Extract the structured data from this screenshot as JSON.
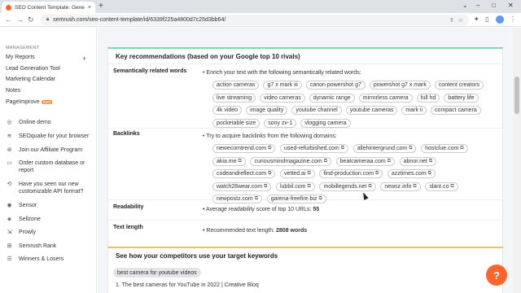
{
  "browser": {
    "tab_title": "SEO Content Template: Generate",
    "tab_close": "×",
    "new_tab": "+",
    "url": "semrush.com/seo-content-template/id/6339f225a4800d7c25d3bb64/",
    "lock_icon": "lock-icon",
    "window_controls": [
      "⌄",
      "–",
      "□",
      "✕"
    ]
  },
  "sidebar": {
    "section_label": "MANAGEMENT",
    "my_reports": "My Reports",
    "lead_gen": "Lead Generation Tool",
    "marketing_calendar": "Marketing Calendar",
    "notes": "Notes",
    "pageimprove": "PageImprove",
    "beta": "Beta",
    "items": [
      {
        "icon": "◎",
        "label": "Online demo"
      },
      {
        "icon": "≋",
        "label": "SEOquake for your browser"
      },
      {
        "icon": "⊛",
        "label": "Join our Affiliate Program"
      },
      {
        "icon": "▭",
        "label": "Order custom database or report"
      },
      {
        "icon": "⟲",
        "label": "Have you seen our new customizable API format?"
      },
      {
        "icon": "◉",
        "label": "Sensor"
      },
      {
        "icon": "◈",
        "label": "Sellzone"
      },
      {
        "icon": "⇲",
        "label": "Prowly"
      },
      {
        "icon": "⊞",
        "label": "Semrush Rank"
      },
      {
        "icon": "☰",
        "label": "Winners & Losers"
      }
    ]
  },
  "recommendations": {
    "title": "Key recommendations (based on your Google top 10 rivals)",
    "semantic": {
      "label": "Semantically related words",
      "intro": "• Enrich your text with the following semantically related words:",
      "words": [
        "action cameras",
        "g7 x mark iii",
        "canon powershot g7",
        "powershot g7 x mark",
        "content creators",
        "live streaming",
        "video cameras",
        "dynamic range",
        "mirrorless camera",
        "full hd",
        "battery life",
        "4k video",
        "image quality",
        "youtube channel",
        "youtube cameras",
        "mark ii",
        "compact camera",
        "pocketable size",
        "sony zv-1",
        "vlogging camera"
      ]
    },
    "backlinks": {
      "label": "Backlinks",
      "intro": "• Try to acquire backlinks from the following domains:",
      "domains": [
        "newecomtrend.com",
        "used-refurbished.com",
        "allehintergrund.com",
        "hostclue.com",
        "akia.me",
        "curiousmindmagazine.com",
        "beatcameraa.com",
        "abnor.net",
        "codeandreflect.com",
        "vetted.ai",
        "find-production.com",
        "azztimes.com",
        "watch28wear.com",
        "lubbil.com",
        "mobillegends.net",
        "newsz.info",
        "slant.co",
        "newpostz.com",
        "garena-freefire.biz"
      ]
    },
    "readability": {
      "label": "Readability",
      "text": "• Average readability score of top 10 URLs:",
      "value": "55"
    },
    "text_length": {
      "label": "Text length",
      "text": "• Recommended text length:",
      "value": "2808 words"
    }
  },
  "competitors": {
    "title": "See how your competitors use your target keywords",
    "keyword": "best camera for youtube videos",
    "partial_text": "1. The best cameras for YouTube in 2022 | Creative Bloq"
  },
  "help_label": "?"
}
